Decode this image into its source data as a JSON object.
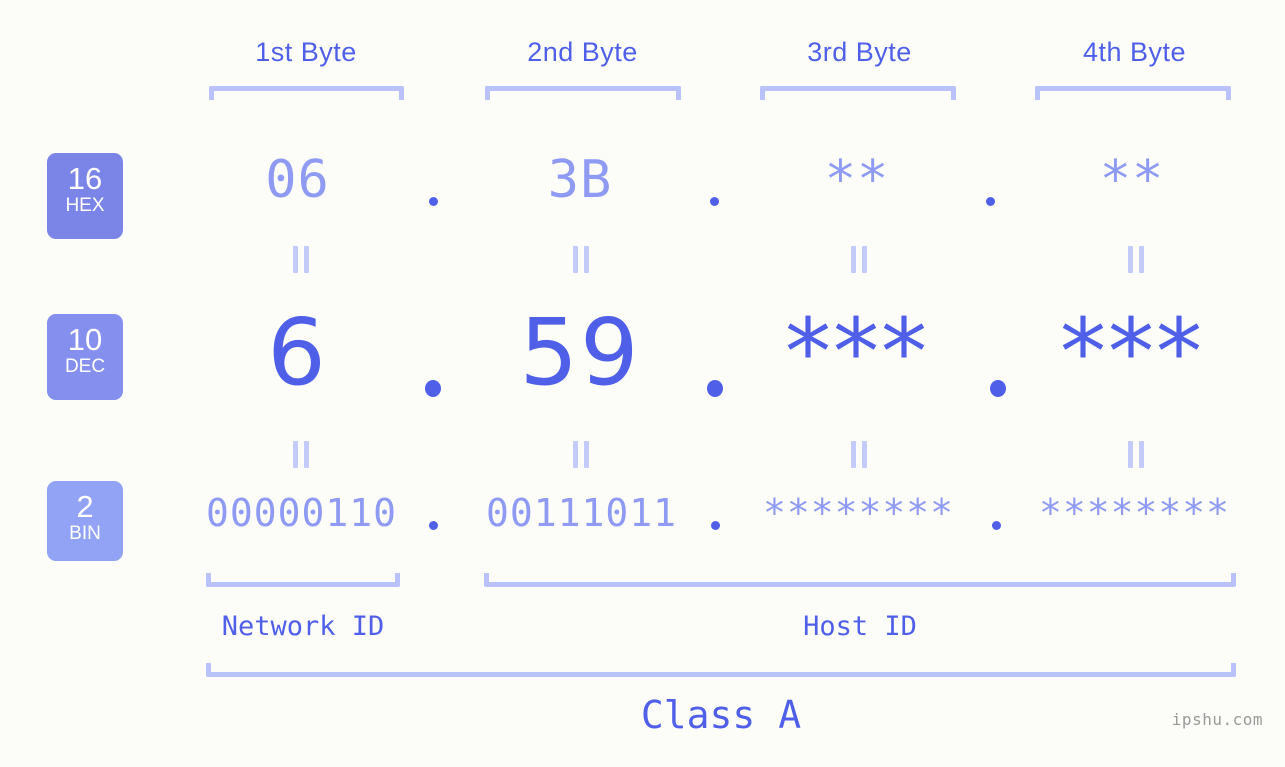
{
  "watermark": "ipshu.com",
  "byte_headers": [
    {
      "label": "1st Byte"
    },
    {
      "label": "2nd Byte"
    },
    {
      "label": "3rd Byte"
    },
    {
      "label": "4th Byte"
    }
  ],
  "rows": [
    {
      "badge_number": "16",
      "badge_radix": "HEX",
      "badge_color": "#7b85e8",
      "values": [
        "06",
        "3B",
        "**",
        "**"
      ]
    },
    {
      "badge_number": "10",
      "badge_radix": "DEC",
      "badge_color": "#8590ee",
      "values": [
        "6",
        "59",
        "***",
        "***"
      ]
    },
    {
      "badge_number": "2",
      "badge_radix": "BIN",
      "badge_color": "#92a3f5",
      "values": [
        "00000110",
        "00111011",
        "********",
        "********"
      ]
    }
  ],
  "separator": ".",
  "segments": {
    "network_id": "Network ID",
    "host_id": "Host ID",
    "class": "Class A"
  },
  "colors": {
    "background": "#fcfdf9",
    "accent_strong": "#4f5fe8",
    "accent_light": "#8f9bf2",
    "bracket": "#b9c2fb",
    "connector": "#c3cbfb"
  }
}
